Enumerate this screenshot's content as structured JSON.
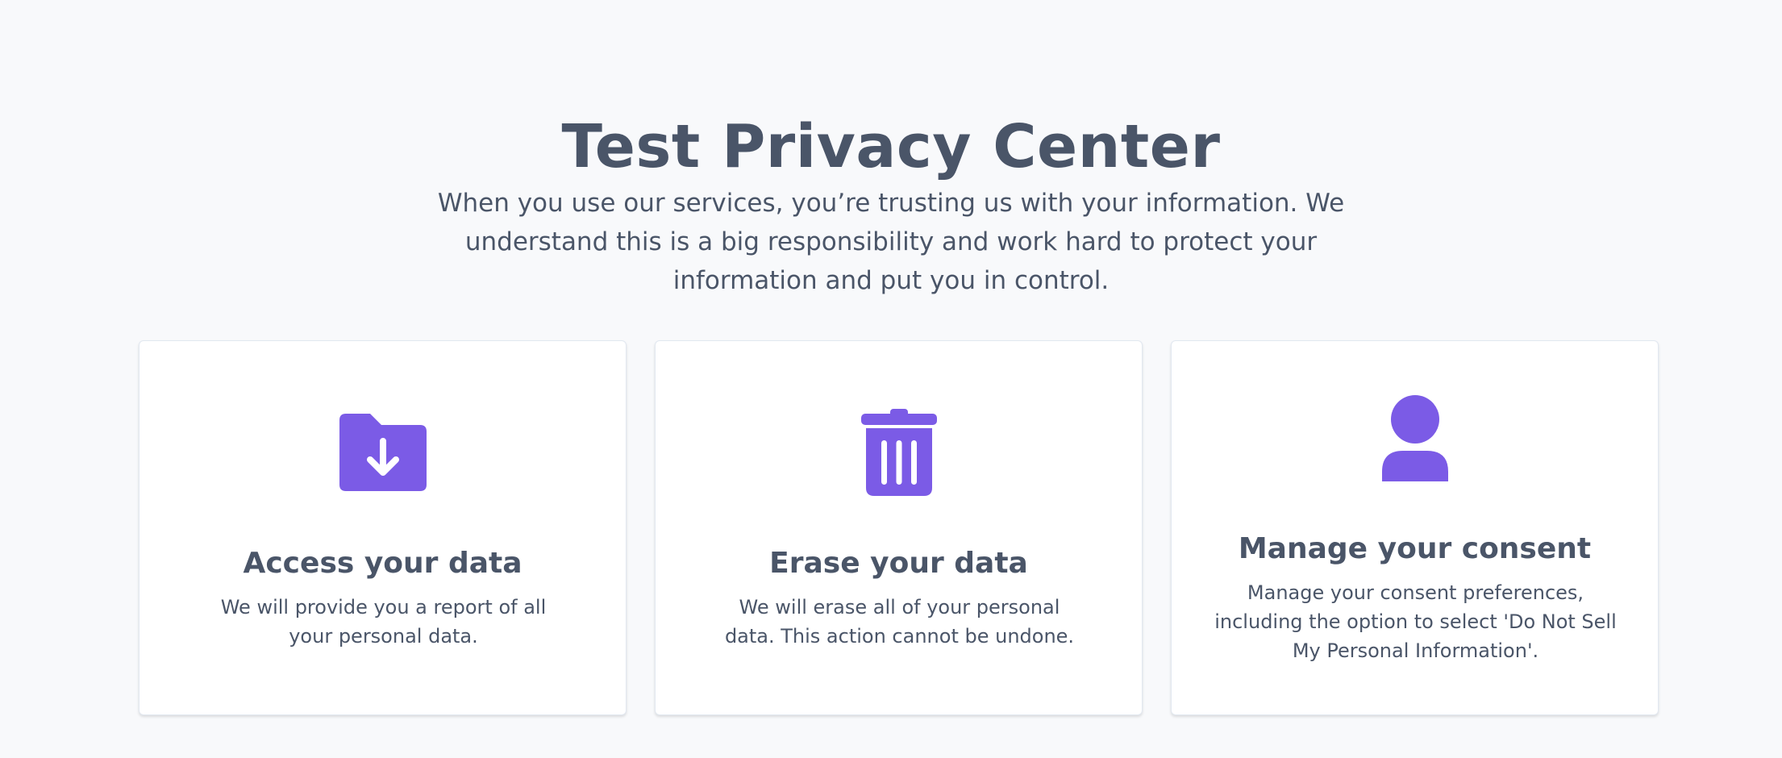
{
  "page": {
    "title": "Test Privacy Center",
    "intro": "When you use our services, you’re trusting us with your information. We understand this is a big responsibility and work hard to protect your information and put you in control."
  },
  "theme": {
    "accent": "#7b5be6",
    "text": "#4a5568",
    "background": "#f8f9fb",
    "card_background": "#ffffff"
  },
  "cards": [
    {
      "icon": "folder-download-icon",
      "title": "Access your data",
      "description": "We will provide you a report of all your personal data."
    },
    {
      "icon": "trash-icon",
      "title": "Erase your data",
      "description": "We will erase all of your personal data. This action cannot be undone."
    },
    {
      "icon": "user-icon",
      "title": "Manage your consent",
      "description": "Manage your consent preferences, including the option to select 'Do Not Sell My Personal Information'."
    }
  ]
}
